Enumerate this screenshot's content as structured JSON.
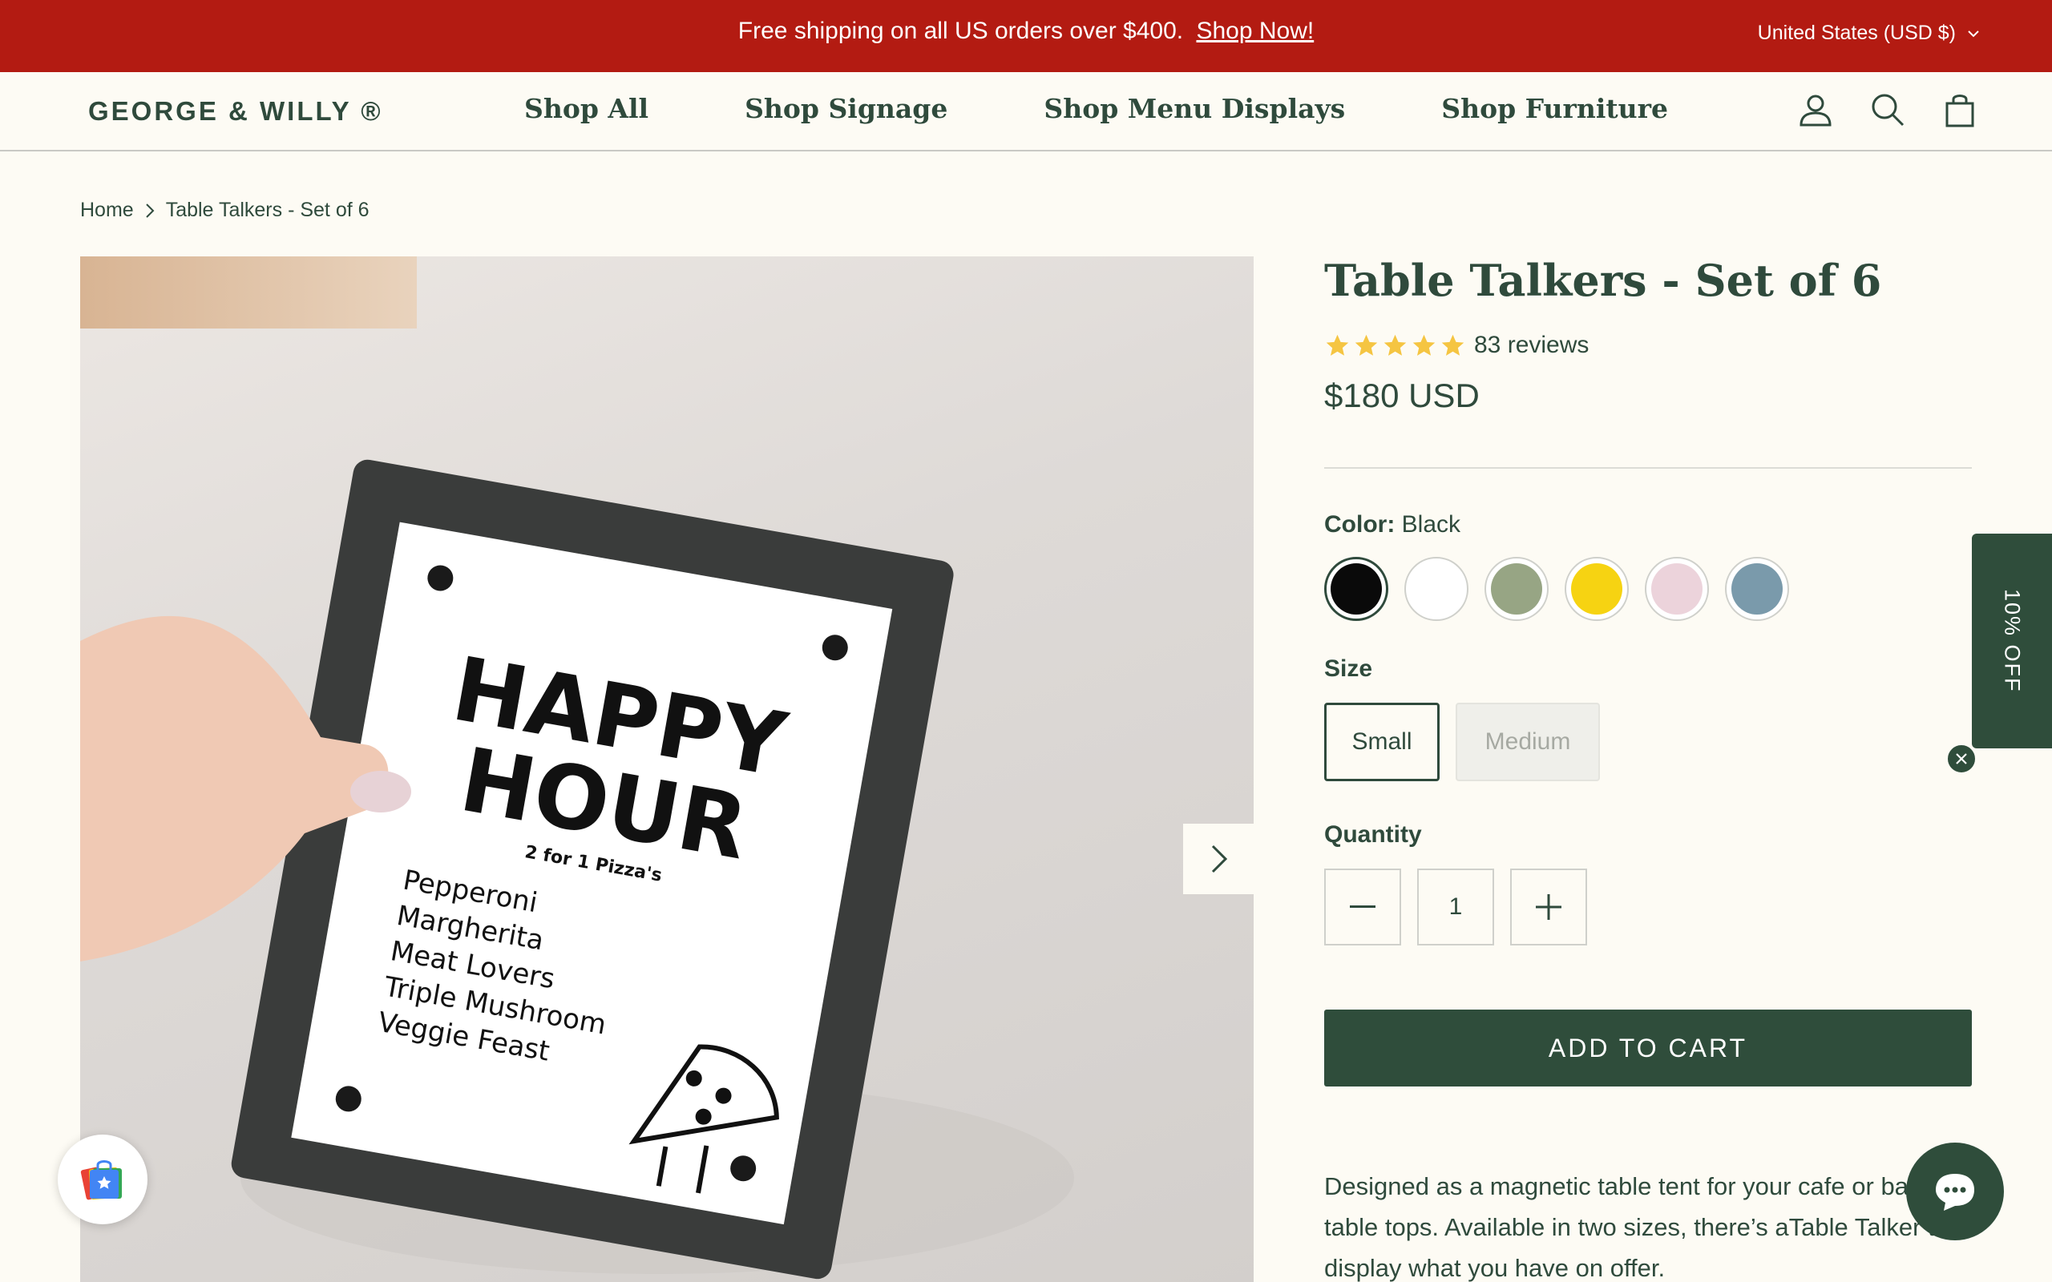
{
  "announcement": {
    "message": "Free shipping on all US orders over $400.",
    "link_label": "Shop Now!",
    "currency_label": "United States (USD $)"
  },
  "header": {
    "logo": "GEORGE & WILLY ®",
    "nav": [
      {
        "label": "Shop All"
      },
      {
        "label": "Shop Signage"
      },
      {
        "label": "Shop Menu Displays"
      },
      {
        "label": "Shop Furniture"
      }
    ],
    "icons": [
      "account-icon",
      "search-icon",
      "cart-icon"
    ]
  },
  "breadcrumb": {
    "home": "Home",
    "current": "Table Talkers - Set of 6"
  },
  "gallery": {
    "sign": {
      "headline_1": "HAPPY",
      "headline_2": "HOUR",
      "subhead": "2 for 1 Pizza's",
      "menu": [
        "Pepperoni",
        "Margherita",
        "Meat Lovers",
        "Triple Mushroom",
        "Veggie Feast"
      ]
    }
  },
  "product": {
    "title": "Table Talkers - Set of 6",
    "rating": 5,
    "reviews": "83 reviews",
    "price": "$180 USD",
    "color_label": "Color:",
    "color_value": "Black",
    "colors": [
      {
        "name": "Black",
        "hex": "#0a0a0a"
      },
      {
        "name": "White",
        "hex": "#ffffff"
      },
      {
        "name": "Sage",
        "hex": "#97a584"
      },
      {
        "name": "Yellow",
        "hex": "#f6d312"
      },
      {
        "name": "Pink",
        "hex": "#ecd3db"
      },
      {
        "name": "Blue",
        "hex": "#7a9aab"
      }
    ],
    "size_label": "Size",
    "sizes": [
      {
        "label": "Small",
        "selected": true
      },
      {
        "label": "Medium",
        "selected": false
      }
    ],
    "quantity_label": "Quantity",
    "quantity": "1",
    "add_to_cart": "ADD TO CART",
    "description": "Designed as a magnetic table tent for your cafe or bar table tops. Available in two sizes, there’s aTable Talker to display what you have on offer."
  },
  "widgets": {
    "promo_tab": "10% OFF"
  },
  "colors": {
    "brand_red": "#b31b12",
    "brand_green": "#2f4d3b",
    "background": "#fdfbf4"
  }
}
